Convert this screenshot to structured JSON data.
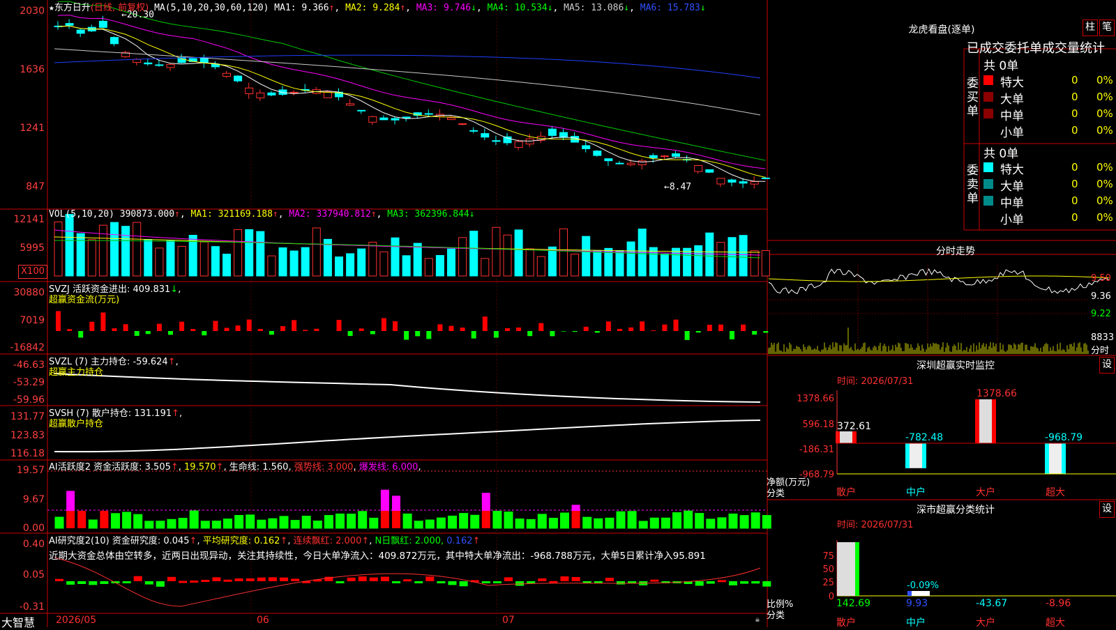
{
  "stock": {
    "name": "东方日升",
    "period_label": "(日线, 前复权)",
    "high_mark": "20.30",
    "low_mark": "8.47"
  },
  "main_chart": {
    "ma_title": "MA(5,10,20,30,60,120)",
    "ma1": "MA1: 9.366",
    "ma2": "MA2: 9.284",
    "ma3": "MA3: 9.746",
    "ma4": "MA4: 10.534",
    "ma5": "MA5: 13.086",
    "ma6": "MA6: 15.783",
    "y_ticks": [
      "2030",
      "1636",
      "1241",
      "847"
    ]
  },
  "vol_chart": {
    "title": "VOL(5,10,20)",
    "value": "390873.000",
    "ma1": "MA1: 321169.188",
    "ma2": "MA2: 337940.812",
    "ma3": "MA3: 362396.844",
    "y_ticks": [
      "12141",
      "5995"
    ],
    "unit": "X100"
  },
  "svzj": {
    "title": "SVZJ  活跃资金进出: 409.831",
    "subtitle": "超赢资金流(万元)",
    "y_ticks": [
      "30880",
      "7019",
      "-16842"
    ]
  },
  "svzl": {
    "title": "SVZL (7) 主力持仓: -59.624",
    "subtitle": "超赢主力持仓",
    "y_ticks": [
      "-46.63",
      "-53.29",
      "-59.96"
    ]
  },
  "svsh": {
    "title": "SVSH (7) 散户持仓: 131.191",
    "subtitle": "超赢散户持仓",
    "y_ticks": [
      "131.77",
      "123.83",
      "116.18"
    ]
  },
  "ai_active": {
    "title": "AI活跃度2 资金活跃度: 3.505",
    "v2": "19.570",
    "life": "生命线: 1.560",
    "strong": "强势线: 3.000",
    "burst": "爆发线: 6.000",
    "y_ticks": [
      "19.57",
      "9.67",
      "0.00"
    ]
  },
  "ai_research": {
    "title": "AI研究度2(10) 资金研究度: 0.045",
    "avg": "平均研究度: 0.162",
    "consecutive": "连续飘红: 2.000",
    "nday": "N日飘红: 2.000,",
    "nday_val": "0.162",
    "comment": "近期大资金总体由空转多，近两日出现异动，关注其持续性，今日大单净流入：409.872万元，其中特大单净流出：-968.788万元，大单5日累计净入95.891",
    "y_ticks": [
      "0.40",
      "0.05",
      "-0.31"
    ]
  },
  "x_axis": {
    "labels": [
      "2026/05",
      "06",
      "07"
    ],
    "brand": "大智慧"
  },
  "right_panel": {
    "lhb_title": "龙虎看盘(逐单)",
    "btn_bar": "柱",
    "btn_pen": "笔",
    "stats_header": "已成交委托单成交量统计",
    "buy_total": "共 0单",
    "sell_total": "共 0单",
    "buy_label": "委买单",
    "sell_label": "委卖单",
    "rows": [
      {
        "label": "特大",
        "count": "0",
        "pct": "0%"
      },
      {
        "label": "大单",
        "count": "0",
        "pct": "0%"
      },
      {
        "label": "中单",
        "count": "0",
        "pct": "0%"
      },
      {
        "label": "小单",
        "count": "0",
        "pct": "0%"
      }
    ],
    "colors": {
      "buy": [
        "#ff0000",
        "#8b0000",
        "#8b0000"
      ],
      "sell": [
        "#00ffff",
        "#008b8b",
        "#008b8b"
      ]
    },
    "intraday_title": "分时走势",
    "intraday_ticks": [
      "9.50",
      "9.36",
      "9.22"
    ],
    "intraday_vol": "8833",
    "intraday_unit": "分时",
    "monitor_title": "深圳超赢实时监控",
    "monitor_btn": "设",
    "monitor_time": "时间: 2026/07/31",
    "monitor_ticks": [
      "1378.66",
      "596.18",
      "-186.31",
      "-968.79"
    ],
    "monitor_axis": "净额(万元)",
    "monitor_axis2": "分类",
    "monitor_cats": [
      "散户",
      "中户",
      "大户",
      "超大"
    ],
    "monitor_values": [
      "372.61",
      "-782.48",
      "1378.66",
      "-968.79"
    ],
    "monitor_data": [
      372.61,
      -782.48,
      1378.66,
      -968.79
    ],
    "class_title": "深市超赢分类统计",
    "class_btn": "设",
    "class_time": "时间: 2026/07/31",
    "class_ticks": [
      "75",
      "50",
      "25",
      "0"
    ],
    "class_axis": "比例%",
    "class_axis2": "分类",
    "class_cats": [
      "散户",
      "中户",
      "大户",
      "超大"
    ],
    "class_values": [
      "142.69",
      "9.93",
      "-43.67",
      "-8.96"
    ],
    "class_pct_label": "-0.09%"
  }
}
